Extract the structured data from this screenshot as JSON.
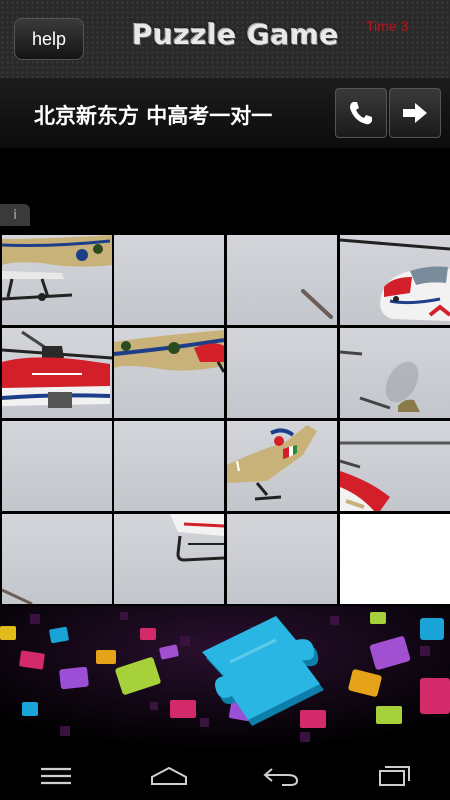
{
  "header": {
    "help_label": "help",
    "title": "Puzzle Game",
    "timer": "Time 3"
  },
  "ad": {
    "text": "北京新东方 中高考一对一",
    "info_glyph": "i",
    "call_icon": "phone-icon",
    "go_icon": "arrow-right-icon"
  },
  "board": {
    "rows": 4,
    "cols": 4,
    "empty_tile": 15
  },
  "colors": {
    "timer": "#c0121a",
    "sky": "#cfd1d6",
    "heli_red": "#d21f2a",
    "heli_khaki": "#c9b27a",
    "heli_blue": "#1d3f8a"
  },
  "navbar": {
    "menu_icon": "menu-icon",
    "home_icon": "home-icon",
    "back_icon": "back-icon",
    "recents_icon": "recent-apps-icon"
  }
}
